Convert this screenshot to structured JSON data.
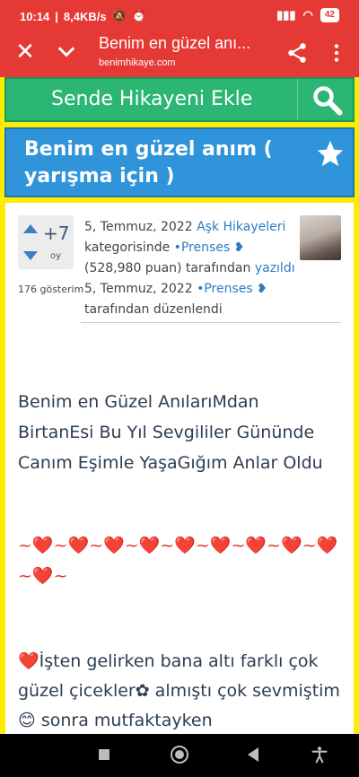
{
  "status": {
    "time": "10:14",
    "speed": "8,4KB/s",
    "battery": "42"
  },
  "appbar": {
    "title": "Benim en güzel anı...",
    "url": "benimhikaye.com"
  },
  "action": {
    "add_story": "Sende Hikayeni Ekle"
  },
  "story_title": "Benim en güzel anım ( yarışma için )",
  "vote": {
    "count": "+7",
    "unit": "oy"
  },
  "views": "176 gösterim",
  "meta": {
    "date1": "5, Temmuz, 2022",
    "category": "Aşk Hikayeleri",
    "cat_suffix": "kategorisinde",
    "author": "•Prenses ❥",
    "points": "(528,980 puan) tarafından",
    "written": "yazıldı",
    "date2": "5, Temmuz, 2022",
    "editor": "•Prenses ❥",
    "edited": "tarafından düzenlendi"
  },
  "story": {
    "line1": "Benim en Güzel AnılarıMdan",
    "line2": "BirtanEsi Bu Yıl Sevgililer Gününde",
    "line3": "Canım Eşimle YaşaGığım Anlar Oldu",
    "hearts": "~❤️~❤️~❤️~❤️~❤️~❤️~❤️~❤️~❤️~❤️~",
    "para": "❤️İşten gelirken bana altı farklı çok güzel çicekler✿  almıştı çok sevmiştim😊 sonra mutfaktayken"
  }
}
